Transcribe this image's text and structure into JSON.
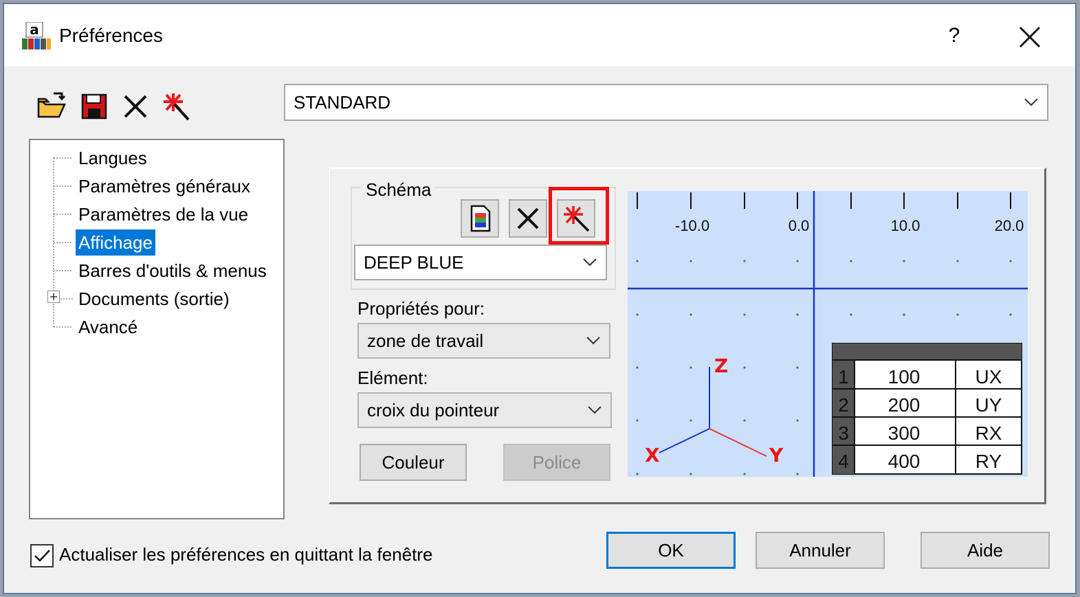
{
  "window": {
    "title": "Préférences",
    "help_label": "?",
    "app_icon_letter": "a"
  },
  "toolbar": {
    "icons": [
      "open-folder-icon",
      "save-icon",
      "delete-icon",
      "reset-icon"
    ]
  },
  "profile_select": {
    "value": "STANDARD"
  },
  "tree": {
    "items": [
      {
        "label": "Langues",
        "selected": false
      },
      {
        "label": "Paramètres généraux",
        "selected": false
      },
      {
        "label": "Paramètres de la vue",
        "selected": false
      },
      {
        "label": "Affichage",
        "selected": true
      },
      {
        "label": "Barres d'outils & menus",
        "selected": false
      },
      {
        "label": "Documents (sortie)",
        "selected": false,
        "expandable": true
      },
      {
        "label": "Avancé",
        "selected": false
      }
    ]
  },
  "schema": {
    "legend": "Schéma",
    "value": "DEEP BLUE",
    "buttons": [
      "new-scheme-icon",
      "delete-scheme-icon",
      "reset-scheme-icon"
    ]
  },
  "properties": {
    "label": "Propriétés pour:",
    "value": "zone de travail"
  },
  "element": {
    "label": "Elément:",
    "value": "croix du pointeur"
  },
  "buttons": {
    "color": "Couleur",
    "font": "Police",
    "ok": "OK",
    "cancel": "Annuler",
    "help": "Aide"
  },
  "preview": {
    "background_color": "#cde0fb",
    "axis_color": "#1a35c8",
    "ruler_labels": [
      "-10.0",
      "0.0",
      "10.0",
      "20.0"
    ],
    "axis_labels": {
      "z": "Z",
      "x": "X",
      "y": "Y"
    },
    "table": {
      "rows": [
        {
          "n": "1",
          "value": "100",
          "dof": "UX"
        },
        {
          "n": "2",
          "value": "200",
          "dof": "UY"
        },
        {
          "n": "3",
          "value": "300",
          "dof": "RX"
        },
        {
          "n": "4",
          "value": "400",
          "dof": "RY"
        }
      ]
    }
  },
  "footer": {
    "checkbox_label": "Actualiser les préférences en quittant la fenêtre",
    "checked": true
  }
}
